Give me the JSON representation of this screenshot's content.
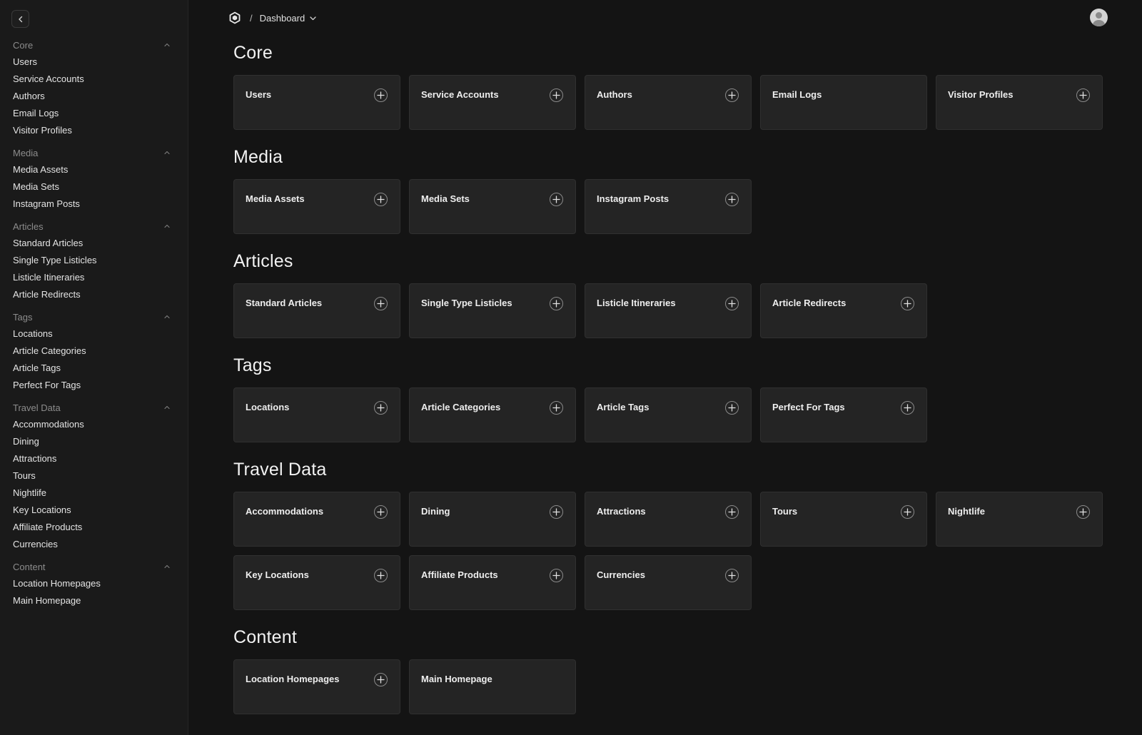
{
  "breadcrumb": {
    "separator": "/",
    "current": "Dashboard"
  },
  "sidebar": {
    "groups": [
      {
        "label": "Core",
        "items": [
          "Users",
          "Service Accounts",
          "Authors",
          "Email Logs",
          "Visitor Profiles"
        ]
      },
      {
        "label": "Media",
        "items": [
          "Media Assets",
          "Media Sets",
          "Instagram Posts"
        ]
      },
      {
        "label": "Articles",
        "items": [
          "Standard Articles",
          "Single Type Listicles",
          "Listicle Itineraries",
          "Article Redirects"
        ]
      },
      {
        "label": "Tags",
        "items": [
          "Locations",
          "Article Categories",
          "Article Tags",
          "Perfect For Tags"
        ]
      },
      {
        "label": "Travel Data",
        "items": [
          "Accommodations",
          "Dining",
          "Attractions",
          "Tours",
          "Nightlife",
          "Key Locations",
          "Affiliate Products",
          "Currencies"
        ]
      },
      {
        "label": "Content",
        "items": [
          "Location Homepages",
          "Main Homepage"
        ]
      }
    ]
  },
  "sections": [
    {
      "title": "Core",
      "cards": [
        {
          "title": "Users",
          "add": true
        },
        {
          "title": "Service Accounts",
          "add": true
        },
        {
          "title": "Authors",
          "add": true
        },
        {
          "title": "Email Logs",
          "add": false
        },
        {
          "title": "Visitor Profiles",
          "add": true
        }
      ]
    },
    {
      "title": "Media",
      "cards": [
        {
          "title": "Media Assets",
          "add": true
        },
        {
          "title": "Media Sets",
          "add": true
        },
        {
          "title": "Instagram Posts",
          "add": true
        }
      ]
    },
    {
      "title": "Articles",
      "cards": [
        {
          "title": "Standard Articles",
          "add": true
        },
        {
          "title": "Single Type Listicles",
          "add": true
        },
        {
          "title": "Listicle Itineraries",
          "add": true
        },
        {
          "title": "Article Redirects",
          "add": true
        }
      ]
    },
    {
      "title": "Tags",
      "cards": [
        {
          "title": "Locations",
          "add": true
        },
        {
          "title": "Article Categories",
          "add": true
        },
        {
          "title": "Article Tags",
          "add": true
        },
        {
          "title": "Perfect For Tags",
          "add": true
        }
      ]
    },
    {
      "title": "Travel Data",
      "cards": [
        {
          "title": "Accommodations",
          "add": true
        },
        {
          "title": "Dining",
          "add": true
        },
        {
          "title": "Attractions",
          "add": true
        },
        {
          "title": "Tours",
          "add": true
        },
        {
          "title": "Nightlife",
          "add": true
        },
        {
          "title": "Key Locations",
          "add": true
        },
        {
          "title": "Affiliate Products",
          "add": true
        },
        {
          "title": "Currencies",
          "add": true
        }
      ]
    },
    {
      "title": "Content",
      "cards": [
        {
          "title": "Location Homepages",
          "add": true
        },
        {
          "title": "Main Homepage",
          "add": false
        }
      ]
    }
  ],
  "colors": {
    "background": "#141414",
    "sidebar": "#1a1a1a",
    "card": "#242424",
    "card_border": "#303030"
  },
  "icons": {
    "collapse": "chevron-left-icon",
    "logo": "hexagon-logo-icon",
    "group_toggle": "chevron-up-icon",
    "add": "plus-circle-icon",
    "user": "user-avatar-icon"
  }
}
